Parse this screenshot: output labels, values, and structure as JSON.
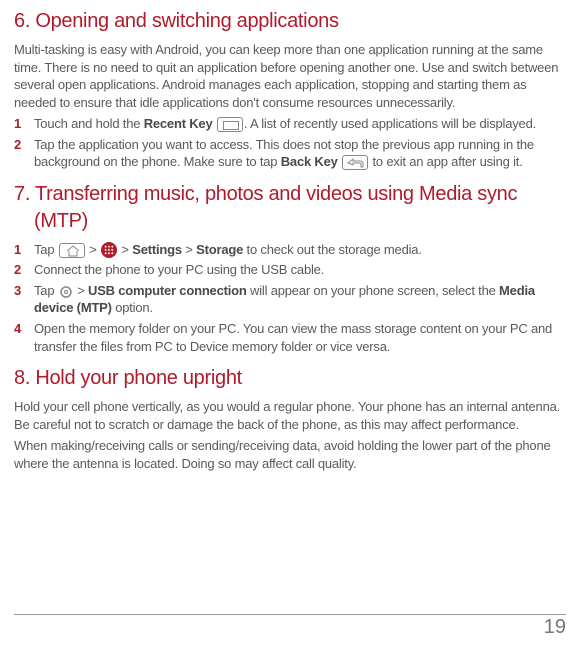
{
  "section6": {
    "heading": "6. Opening and switching applications",
    "intro": "Multi-tasking is easy with Android, you can keep more than one application running at the same time. There is no need to quit an application before opening another one. Use and switch between several open applications. Android manages each application, stopping and starting them as needed to ensure that idle applications don't consume resources unnecessarily.",
    "steps": [
      {
        "num": "1",
        "pre": "Touch and hold the ",
        "bold1": "Recent Key ",
        "post": ". A list of recently used applications will be displayed."
      },
      {
        "num": "2",
        "pre": "Tap the application you want to access. This does not stop the previous app running in the background on the phone. Make sure to tap ",
        "bold1": "Back Key ",
        "post": " to exit an app after using it."
      }
    ]
  },
  "section7": {
    "heading": "7. Transferring music, photos and videos using Media sync (MTP)",
    "steps": [
      {
        "num": "1",
        "pre": "Tap ",
        "gt1": " > ",
        "gt2": " > ",
        "bold1": "Settings",
        "mid": " > ",
        "bold2": "Storage",
        "post": " to check out the storage media."
      },
      {
        "num": "2",
        "text": "Connect the phone to your PC using the USB cable."
      },
      {
        "num": "3",
        "pre": "Tap ",
        "gt1": " > ",
        "bold1": "USB computer connection",
        "mid": " will appear on your phone screen, select the ",
        "bold2": "Media device (MTP)",
        "post": " option."
      },
      {
        "num": "4",
        "text": "Open the memory folder on your PC. You can view the mass storage content on your PC and transfer the files from PC to Device memory folder or vice versa."
      }
    ]
  },
  "section8": {
    "heading": "8. Hold your phone upright",
    "para1": "Hold your cell phone vertically, as you would a regular phone. Your phone has an internal antenna. Be careful not to scratch or damage the back of the phone, as this may affect performance.",
    "para2": "When making/receiving calls or sending/receiving data, avoid holding the lower part of the phone where the antenna is located. Doing so may affect call quality."
  },
  "pageNumber": "19"
}
